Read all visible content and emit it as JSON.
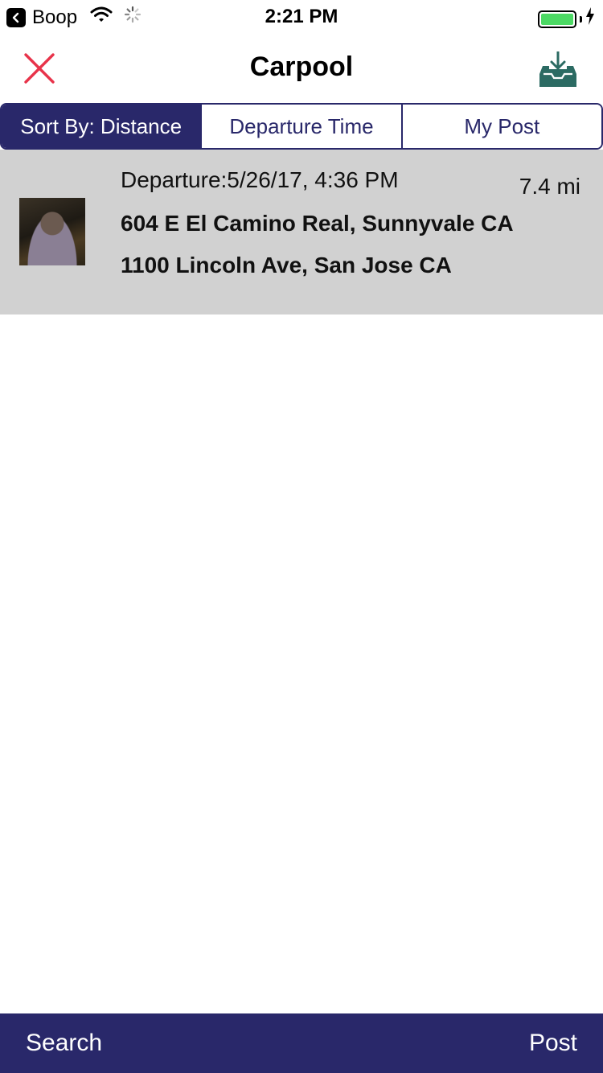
{
  "status_bar": {
    "back_app": "Boop",
    "time": "2:21 PM",
    "icons": [
      "back-arrow-icon",
      "wifi-icon",
      "activity-spinner-icon",
      "battery-icon",
      "charging-bolt-icon"
    ],
    "battery_level": 1.0,
    "battery_color": "#4cd964"
  },
  "nav": {
    "title": "Carpool",
    "close_icon": "close-icon",
    "close_color": "#e8334a",
    "download_icon": "inbox-download-icon",
    "download_color": "#2c6b63"
  },
  "sort": {
    "segments": [
      {
        "label": "Sort By: Distance",
        "selected": true
      },
      {
        "label": "Departure Time",
        "selected": false
      },
      {
        "label": "My Post",
        "selected": false
      }
    ],
    "accent": "#29286a"
  },
  "rides": [
    {
      "departure": "Departure:5/26/17, 4:36 PM",
      "distance": "7.4 mi",
      "from": "604 E El Camino Real, Sunnyvale CA",
      "to": "1100 Lincoln Ave, San Jose CA"
    }
  ],
  "tab_bar": {
    "search_label": "Search",
    "post_label": "Post",
    "background": "#29286a"
  }
}
